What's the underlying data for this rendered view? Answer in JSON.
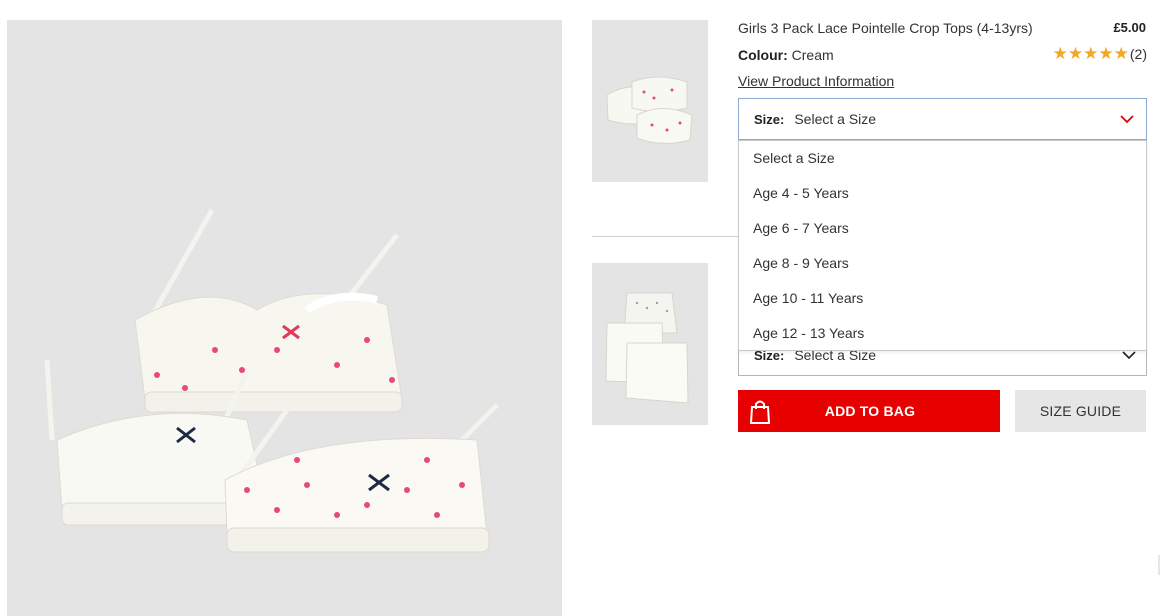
{
  "product": {
    "title": "Girls 3 Pack Lace Pointelle Crop Tops (4-13yrs)",
    "price": "£5.00",
    "colour_label": "Colour:",
    "colour_value": "Cream",
    "rating_stars": "★★★★★",
    "rating_count": "(2)",
    "info_link": "View Product Information"
  },
  "size_select": {
    "label": "Size:",
    "value": "Select a Size",
    "options": [
      "Select a Size",
      "Age 4 - 5 Years",
      "Age 6 - 7 Years",
      "Age 8 - 9 Years",
      "Age 10 - 11 Years",
      "Age 12 - 13 Years"
    ]
  },
  "size_select_2": {
    "label": "Size:",
    "value": "Select a Size"
  },
  "actions": {
    "add_to_bag": "ADD TO BAG",
    "size_guide": "SIZE GUIDE"
  },
  "icons": {
    "bag": "shopping-bag-icon",
    "chevron": "chevron-down-icon",
    "star": "star-icon"
  },
  "colors": {
    "accent_red": "#e60000",
    "star_gold": "#f5a623",
    "image_bg": "#e4e4e4",
    "select_border_focus": "#8ea9d3"
  }
}
